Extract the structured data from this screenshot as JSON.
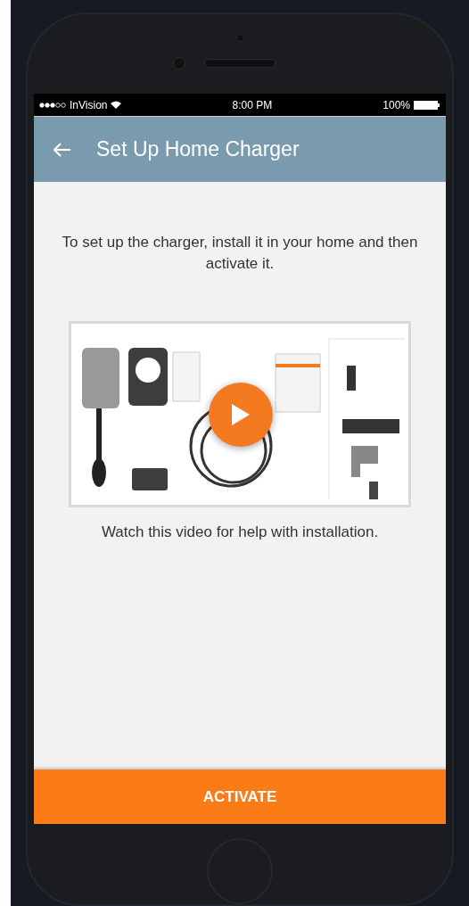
{
  "status_bar": {
    "carrier": "InVision",
    "time": "8:00 PM",
    "battery": "100%"
  },
  "header": {
    "title": "Set Up Home Charger"
  },
  "intro": "To set up the charger, install it in your home and then activate it.",
  "video": {
    "caption": "Watch this video for help with installation."
  },
  "buttons": [
    {
      "label": "ACTIVATE"
    }
  ]
}
